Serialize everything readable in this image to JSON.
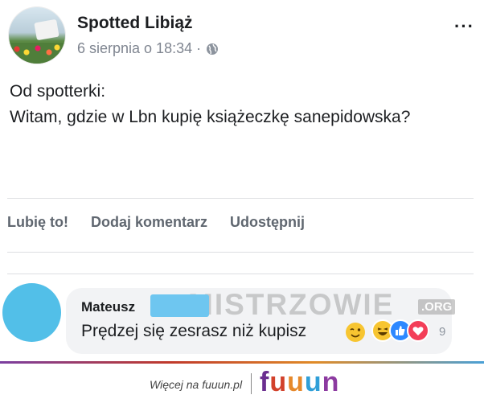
{
  "post": {
    "page_name": "Spotted Libiąż",
    "timestamp": "6 sierpnia o 18:34 ·",
    "body_line1": "Od spotterki:",
    "body_line2": "Witam, gdzie w Lbn kupię książeczkę sanepidowska?"
  },
  "actions": {
    "like": "Lubię to!",
    "comment": "Dodaj komentarz",
    "share": "Udostępnij"
  },
  "comment": {
    "author": "Mateusz",
    "text": "Prędzej się zesrasz niż kupisz",
    "reaction_count": "9"
  },
  "watermark": {
    "text": "MISTRZOWIE",
    "org": ".ORG"
  },
  "footer": {
    "more_text": "Więcej na fuuun.pl",
    "logo_letters": [
      "f",
      "u",
      "u",
      "u",
      "n"
    ],
    "logo_colors": [
      "#6b2e8f",
      "#d2412b",
      "#e6892b",
      "#2f9fd8",
      "#8c3aa0"
    ]
  },
  "colors": {
    "reaction_haha": "#f7c531",
    "reaction_like": "#2d88ff",
    "reaction_love": "#f33e58",
    "commenter_avatar": "#52bfe8"
  }
}
